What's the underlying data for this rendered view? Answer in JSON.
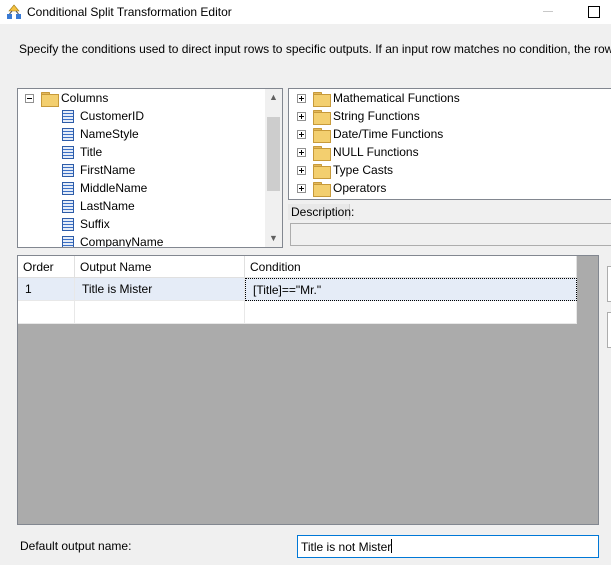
{
  "window": {
    "title": "Conditional Split Transformation Editor"
  },
  "instructions": "Specify the conditions used to direct input rows to specific outputs. If an input row matches no condition, the row is directed to a default output.",
  "columns_tree": {
    "root_label": "Columns",
    "items": [
      "CustomerID",
      "NameStyle",
      "Title",
      "FirstName",
      "MiddleName",
      "LastName",
      "Suffix",
      "CompanyName"
    ]
  },
  "functions_tree": {
    "items": [
      "Mathematical Functions",
      "String Functions",
      "Date/Time Functions",
      "NULL Functions",
      "Type Casts",
      "Operators"
    ]
  },
  "description": {
    "label": "Description:",
    "value": ""
  },
  "conditions_grid": {
    "headers": [
      "Order",
      "Output Name",
      "Condition"
    ],
    "rows": [
      {
        "order": "1",
        "output_name": "Title is Mister",
        "condition": "[Title]==\"Mr.\""
      }
    ]
  },
  "default_output": {
    "label": "Default output name:",
    "value": "Title is not Mister"
  },
  "colors": {
    "selected_row": "#e5ecf7",
    "focus_border": "#0078d7",
    "grid_background": "#ababab"
  }
}
